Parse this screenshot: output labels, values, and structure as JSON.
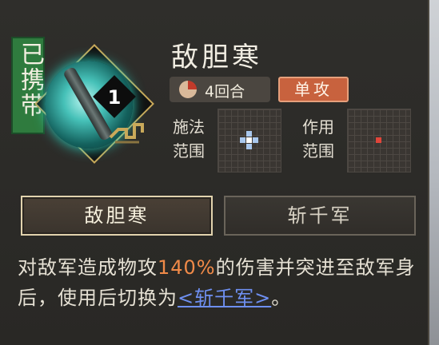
{
  "skill": {
    "status_label": "已携带",
    "level": "1",
    "name": "敌胆寒",
    "rounds": "4回合",
    "attack_type": "单攻",
    "cast_range_label_1": "施法",
    "cast_range_label_2": "范围",
    "effect_range_label_1": "作用",
    "effect_range_label_2": "范围"
  },
  "tabs": [
    {
      "label": "敌胆寒",
      "active": true
    },
    {
      "label": "斩千军",
      "active": false
    }
  ],
  "description": {
    "part1": "对敌军造成物攻",
    "percent": "140%",
    "part2": "的伤害并突进至敌军身后，使用后切换为",
    "link": "<斩千军>",
    "part3": "。"
  },
  "colors": {
    "accent_orange": "#f08a48",
    "link_blue": "#6e8ff0",
    "banner_green": "#2f7b3e",
    "tag_orange": "#c8623e",
    "cast_cell": "#a9c8ee",
    "effect_cell": "#e0453a"
  }
}
